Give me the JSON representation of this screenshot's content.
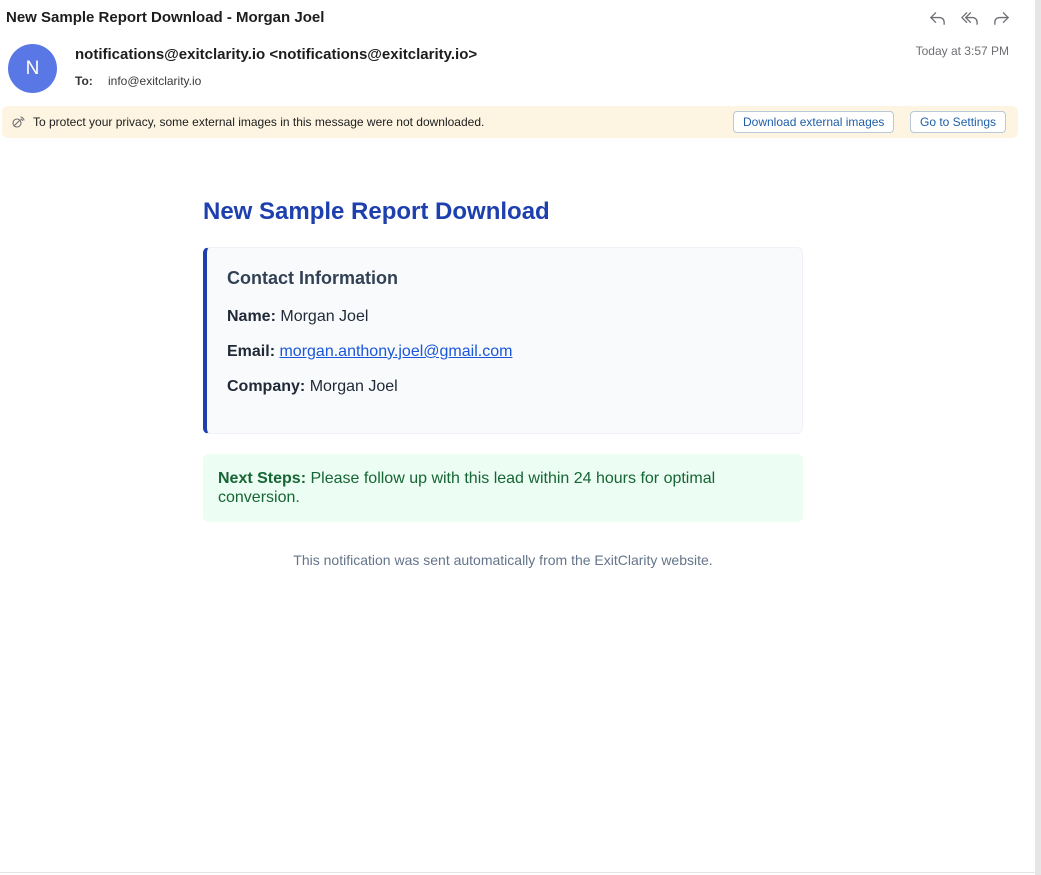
{
  "header": {
    "subject": "New Sample Report Download - Morgan Joel",
    "actions": [
      {
        "name": "reply",
        "icon": "reply-icon"
      },
      {
        "name": "reply-all",
        "icon": "reply-all-icon"
      },
      {
        "name": "forward",
        "icon": "forward-icon"
      }
    ],
    "avatar_initial": "N",
    "avatar_color": "#5a77e6",
    "sender": "notifications@exitclarity.io <notifications@exitclarity.io>",
    "to_label": "To:",
    "to_value": "info@exitclarity.io",
    "timestamp": "Today at 3:57 PM"
  },
  "privacy_banner": {
    "icon": "privacy-shield-icon",
    "text": "To protect your privacy, some external images in this message were not downloaded.",
    "download_button": "Download external images",
    "settings_button": "Go to Settings"
  },
  "email": {
    "title": "New Sample Report Download",
    "title_color": "#1e40af",
    "contact": {
      "heading": "Contact Information",
      "name_label": "Name:",
      "name_value": "Morgan Joel",
      "email_label": "Email:",
      "email_value": "morgan.anthony.joel@gmail.com",
      "company_label": "Company:",
      "company_value": "Morgan Joel"
    },
    "next_steps": {
      "label": "Next Steps:",
      "text": "Please follow up with this lead within 24 hours for optimal conversion."
    },
    "footer": "This notification was sent automatically from the ExitClarity website."
  }
}
